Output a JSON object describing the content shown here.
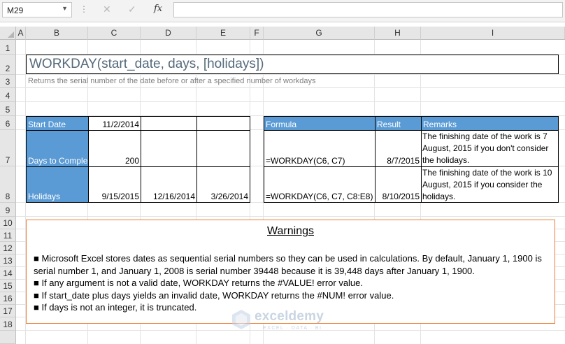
{
  "namebox": {
    "value": "M29"
  },
  "formula_bar": {
    "cancel_icon": "✕",
    "enter_icon": "✓",
    "fx_label": "fx",
    "value": ""
  },
  "columns": [
    "A",
    "B",
    "C",
    "D",
    "E",
    "F",
    "G",
    "H",
    "I"
  ],
  "rows": [
    "1",
    "2",
    "3",
    "4",
    "5",
    "6",
    "7",
    "8",
    "9",
    "10",
    "11",
    "12",
    "13",
    "14",
    "15",
    "16",
    "17",
    "18"
  ],
  "title": "WORKDAY(start_date, days, [holidays])",
  "subtitle": "Returns the serial number of the date before or after a specified number of workdays",
  "input_table": {
    "start_label": "Start Date",
    "start_value": "11/2/2014",
    "days_label": "Days to Comple",
    "days_value": "200",
    "holidays_label": "Holidays",
    "holidays": [
      "9/15/2015",
      "12/16/2014",
      "3/26/2014"
    ]
  },
  "result_table": {
    "headers": [
      "Formula",
      "Result",
      "Remarks"
    ],
    "rows": [
      {
        "formula": "=WORKDAY(C6, C7)",
        "result": "8/7/2015",
        "remark": "The finishing date of the work is 7 August, 2015 if you don't consider the holidays."
      },
      {
        "formula": "=WORKDAY(C6, C7, C8:E8)",
        "result": "8/10/2015",
        "remark": "The finishing date of the work is 10 August, 2015 if you consider the holidays."
      }
    ]
  },
  "warnings": {
    "title": "Warnings",
    "items": [
      "■ Microsoft Excel stores dates as sequential serial numbers so they can be used in calculations. By default, January 1, 1900 is serial number 1, and January 1, 2008 is serial number 39448 because it is 39,448 days after January 1, 1900.",
      "■ If any argument is not a valid date, WORKDAY returns the #VALUE! error value.",
      "■ If start_date plus days yields an invalid date, WORKDAY returns the #NUM! error value.",
      "■ If days is not an integer, it is truncated."
    ]
  },
  "watermark": {
    "name": "exceldemy",
    "tagline": "EXCEL · DATA · BI"
  },
  "colors": {
    "header_fill": "#5b9bd5",
    "warning_border": "#ed7d31",
    "title_text": "#546a7b"
  }
}
